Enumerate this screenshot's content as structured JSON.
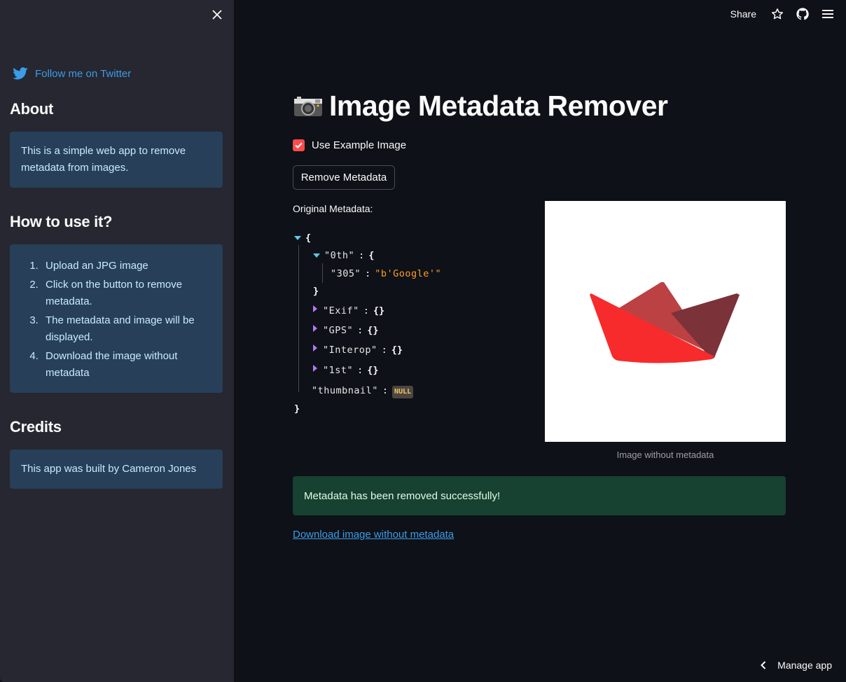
{
  "sidebar": {
    "close_icon": "close-icon",
    "twitter_link": "Follow me on Twitter",
    "sections": [
      {
        "heading": "About",
        "text": "This is a simple web app to remove metadata from images."
      },
      {
        "heading": "How to use it?",
        "steps": [
          "Upload an JPG image",
          "Click on the button to remove metadata.",
          "The metadata and image will be displayed.",
          "Download the image without metadata"
        ]
      },
      {
        "heading": "Credits",
        "text": "This app was built by Cameron Jones"
      }
    ]
  },
  "topbar": {
    "share_label": "Share",
    "icons": [
      "star-icon",
      "github-icon",
      "hamburger-menu-icon"
    ]
  },
  "main": {
    "title_emoji": "camera-icon",
    "title": "Image Metadata Remover",
    "checkbox": {
      "label": "Use Example Image",
      "checked": true
    },
    "remove_button": "Remove Metadata",
    "original_metadata_label": "Original Metadata:",
    "metadata_json": {
      "open_brace": "{",
      "close_brace": "}",
      "entries": [
        {
          "key": "\"0th\"",
          "expanded": true,
          "children": [
            {
              "key": "\"305\"",
              "value": "\"b'Google'\""
            }
          ]
        },
        {
          "key": "\"Exif\"",
          "value": "{}"
        },
        {
          "key": "\"GPS\"",
          "value": "{}"
        },
        {
          "key": "\"Interop\"",
          "value": "{}"
        },
        {
          "key": "\"1st\"",
          "value": "{}"
        },
        {
          "key": "\"thumbnail\"",
          "value": "NULL"
        }
      ]
    },
    "image_caption": "Image without metadata",
    "image_colors": {
      "left": "#f72b2b",
      "middle": "#bb4143",
      "right": "#7b3239"
    },
    "success_message": "Metadata has been removed successfully!",
    "download_link": "Download image without metadata"
  },
  "footer": {
    "manage_app": "Manage app"
  },
  "colors": {
    "accent": "#ff4b4b",
    "link": "#3b9ce9",
    "sidebar_bg": "#262730",
    "main_bg": "#0e1117",
    "info_bg": "#273f59",
    "success_bg": "#174130"
  }
}
